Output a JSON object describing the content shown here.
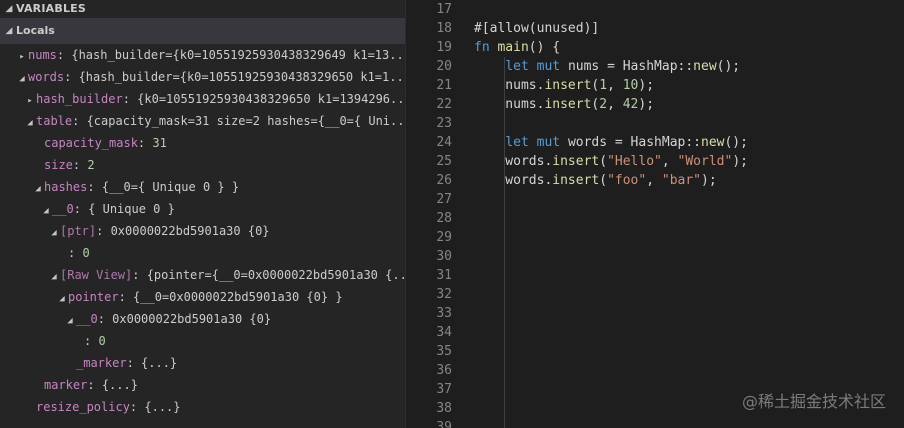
{
  "variables_panel": {
    "header": "VARIABLES",
    "scope": "Locals",
    "rows": [
      {
        "indent": 1,
        "twisty": "right",
        "name": "nums",
        "value": "{hash_builder={k0=10551925930438329649 k1=13...",
        "name_style": "field"
      },
      {
        "indent": 1,
        "twisty": "down",
        "name": "words",
        "value": "{hash_builder={k0=10551925930438329650 k1=1...",
        "name_style": "field"
      },
      {
        "indent": 2,
        "twisty": "right",
        "name": "hash_builder",
        "value": "{k0=10551925930438329650 k1=1394296...",
        "name_style": "field"
      },
      {
        "indent": 2,
        "twisty": "down",
        "name": "table",
        "value": "{capacity_mask=31 size=2 hashes={__0={ Uni...",
        "name_style": "field"
      },
      {
        "indent": 3,
        "twisty": "",
        "name": "capacity_mask",
        "value": "31",
        "name_style": "field"
      },
      {
        "indent": 3,
        "twisty": "",
        "name": "size",
        "value": "2",
        "name_style": "field"
      },
      {
        "indent": 3,
        "twisty": "down",
        "name": "hashes",
        "value": "{__0={ Unique 0 } }",
        "name_style": "field"
      },
      {
        "indent": 4,
        "twisty": "down",
        "name": "__0",
        "value": "{ Unique 0 }",
        "name_style": "field"
      },
      {
        "indent": 5,
        "twisty": "down",
        "name": "[ptr]",
        "value": "0x0000022bd5901a30 {0}",
        "name_style": "virtual"
      },
      {
        "indent": 6,
        "twisty": "",
        "name": "",
        "value": "0",
        "name_style": "field"
      },
      {
        "indent": 5,
        "twisty": "down",
        "name": "[Raw View]",
        "value": "{pointer={__0=0x0000022bd5901a30 {...",
        "name_style": "virtual"
      },
      {
        "indent": 6,
        "twisty": "down",
        "name": "pointer",
        "value": "{__0=0x0000022bd5901a30 {0} }",
        "name_style": "field"
      },
      {
        "indent": 7,
        "twisty": "down",
        "name": "__0",
        "value": "0x0000022bd5901a30 {0}",
        "name_style": "field"
      },
      {
        "indent": 8,
        "twisty": "",
        "name": "",
        "value": "0",
        "name_style": "field"
      },
      {
        "indent": 7,
        "twisty": "",
        "name": "_marker",
        "value": "{...}",
        "name_style": "field"
      },
      {
        "indent": 3,
        "twisty": "",
        "name": "marker",
        "value": "{...}",
        "name_style": "field"
      },
      {
        "indent": 2,
        "twisty": "",
        "name": "resize_policy",
        "value": "{...}",
        "name_style": "field"
      }
    ]
  },
  "editor": {
    "lines": [
      {
        "num": "17",
        "tokens": []
      },
      {
        "num": "18",
        "tokens": [
          {
            "t": "#[allow(unused)]",
            "c": "plain"
          }
        ]
      },
      {
        "num": "19",
        "tokens": [
          {
            "t": "fn ",
            "c": "kw"
          },
          {
            "t": "main",
            "c": "fn"
          },
          {
            "t": "() {",
            "c": "plain"
          }
        ]
      },
      {
        "num": "20",
        "tokens": [
          {
            "t": "    ",
            "c": "plain"
          },
          {
            "t": "let ",
            "c": "kw"
          },
          {
            "t": "mut ",
            "c": "kw"
          },
          {
            "t": "nums",
            "c": "plain"
          },
          {
            "t": " = HashMap::",
            "c": "plain"
          },
          {
            "t": "new",
            "c": "fn"
          },
          {
            "t": "();",
            "c": "plain"
          }
        ]
      },
      {
        "num": "21",
        "tokens": [
          {
            "t": "    nums.",
            "c": "plain"
          },
          {
            "t": "insert",
            "c": "fn"
          },
          {
            "t": "(",
            "c": "plain"
          },
          {
            "t": "1",
            "c": "nmb"
          },
          {
            "t": ", ",
            "c": "plain"
          },
          {
            "t": "10",
            "c": "nmb"
          },
          {
            "t": ");",
            "c": "plain"
          }
        ]
      },
      {
        "num": "22",
        "tokens": [
          {
            "t": "    nums.",
            "c": "plain"
          },
          {
            "t": "insert",
            "c": "fn"
          },
          {
            "t": "(",
            "c": "plain"
          },
          {
            "t": "2",
            "c": "nmb"
          },
          {
            "t": ", ",
            "c": "plain"
          },
          {
            "t": "42",
            "c": "nmb"
          },
          {
            "t": ");",
            "c": "plain"
          }
        ]
      },
      {
        "num": "23",
        "tokens": []
      },
      {
        "num": "24",
        "tokens": [
          {
            "t": "    ",
            "c": "plain"
          },
          {
            "t": "let ",
            "c": "kw"
          },
          {
            "t": "mut ",
            "c": "kw"
          },
          {
            "t": "words",
            "c": "plain"
          },
          {
            "t": " = HashMap::",
            "c": "plain"
          },
          {
            "t": "new",
            "c": "fn"
          },
          {
            "t": "();",
            "c": "plain"
          }
        ]
      },
      {
        "num": "25",
        "tokens": [
          {
            "t": "    words.",
            "c": "plain"
          },
          {
            "t": "insert",
            "c": "fn"
          },
          {
            "t": "(",
            "c": "plain"
          },
          {
            "t": "\"Hello\"",
            "c": "str"
          },
          {
            "t": ", ",
            "c": "plain"
          },
          {
            "t": "\"World\"",
            "c": "str"
          },
          {
            "t": ");",
            "c": "plain"
          }
        ]
      },
      {
        "num": "26",
        "tokens": [
          {
            "t": "    words.",
            "c": "plain"
          },
          {
            "t": "insert",
            "c": "fn"
          },
          {
            "t": "(",
            "c": "plain"
          },
          {
            "t": "\"foo\"",
            "c": "str"
          },
          {
            "t": ", ",
            "c": "plain"
          },
          {
            "t": "\"bar\"",
            "c": "str"
          },
          {
            "t": ");",
            "c": "plain"
          }
        ]
      },
      {
        "num": "27",
        "tokens": []
      },
      {
        "num": "28",
        "tokens": []
      },
      {
        "num": "29",
        "tokens": []
      },
      {
        "num": "30",
        "tokens": []
      },
      {
        "num": "31",
        "tokens": []
      },
      {
        "num": "32",
        "tokens": []
      },
      {
        "num": "33",
        "tokens": []
      },
      {
        "num": "34",
        "tokens": []
      },
      {
        "num": "35",
        "tokens": []
      },
      {
        "num": "36",
        "tokens": []
      },
      {
        "num": "37",
        "tokens": []
      },
      {
        "num": "38",
        "tokens": []
      },
      {
        "num": "39",
        "tokens": []
      }
    ]
  },
  "watermark": "@稀土掘金技术社区",
  "colors": {
    "editor_bg": "#1e1e1e",
    "panel_bg": "#252526",
    "keyword": "#569cd6",
    "function": "#dcdcaa",
    "string": "#ce9178",
    "number": "#b5cea8",
    "var_name": "#c586c0",
    "line_number": "#858585"
  }
}
